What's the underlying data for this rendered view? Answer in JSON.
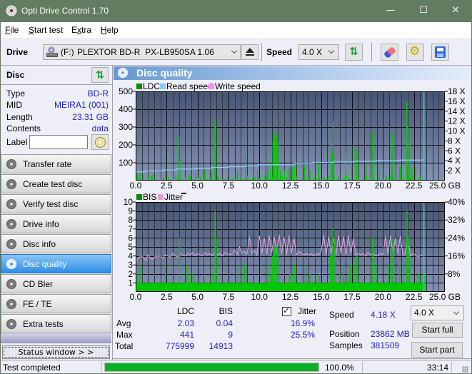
{
  "window": {
    "title": "Opti Drive Control 1.70",
    "minimize_glyph": "—",
    "maximize_glyph": "☐",
    "close_glyph": "✕"
  },
  "menu": [
    {
      "pre": "",
      "key": "F",
      "post": "ile"
    },
    {
      "pre": "",
      "key": "S",
      "post": "tart test"
    },
    {
      "pre": "E",
      "key": "x",
      "post": "tra"
    },
    {
      "pre": "",
      "key": "H",
      "post": "elp"
    }
  ],
  "toolbar": {
    "drive_label": "Drive",
    "drive_letter": "(F:)",
    "drive_name": "PLEXTOR BD-R  PX-LB950SA 1.06",
    "speed_label": "Speed",
    "speed_value": "4.0 X"
  },
  "disc": {
    "header": "Disc",
    "fields": [
      {
        "label": "Type",
        "value": "BD-R"
      },
      {
        "label": "MID",
        "value": "MEIRA1 (001)"
      },
      {
        "label": "Length",
        "value": "23.31 GB"
      },
      {
        "label": "Contents",
        "value": "data"
      }
    ],
    "label_field": {
      "label": "Label",
      "value": ""
    }
  },
  "nav": {
    "items": [
      "Transfer rate",
      "Create test disc",
      "Verify test disc",
      "Drive info",
      "Disc info",
      "Disc quality",
      "CD Bler",
      "FE / TE",
      "Extra tests"
    ],
    "selected": "Disc quality"
  },
  "status_window_button": "Status window > >",
  "panel": {
    "title": "Disc quality"
  },
  "stats": {
    "col_ldc": "LDC",
    "col_bis": "BIS",
    "rows": [
      {
        "label": "Avg",
        "ldc": "2.03",
        "bis": "0.04",
        "jitter": "16.9%"
      },
      {
        "label": "Max",
        "ldc": "441",
        "bis": "9",
        "jitter": "25.5%"
      },
      {
        "label": "Total",
        "ldc": "775999",
        "bis": "14913"
      }
    ],
    "jitter_label": "Jitter",
    "jitter_checked": true,
    "speed_label": "Speed",
    "speed_value": "4.18 X",
    "position_label": "Position",
    "position_value": "23862 MB",
    "samples_label": "Samples",
    "samples_value": "381509",
    "speed_select": "4.0 X",
    "start_full": "Start full",
    "start_part": "Start part"
  },
  "statusbar": {
    "text": "Test completed",
    "progress_percent": 100.0,
    "progress_text": "100.0%",
    "elapsed": "33:14"
  },
  "colors": {
    "titlebar": "#627c62",
    "value_text": "#2222cc",
    "selected_nav": "#2e8ee8",
    "bars": "#00c800",
    "read_speed": "#88ccff",
    "jitter": "#e0a6e0",
    "end_marker": "#40c8f8",
    "progress": "#06b025"
  },
  "chart_data": [
    {
      "id": "ldc",
      "type": "bar",
      "title": "",
      "legend": [
        {
          "label": "LDC",
          "color": "#008c00"
        },
        {
          "label": "Read speed",
          "color": "#88ccff"
        },
        {
          "label": "Write speed",
          "color": "#ff88ff"
        }
      ],
      "legend_position": "top-left",
      "xlabel": "GB",
      "xlim": [
        0,
        25
      ],
      "x_ticks": [
        0,
        2.5,
        5,
        7.5,
        10,
        12.5,
        15,
        17.5,
        20,
        22.5,
        25
      ],
      "x_tick_labels": [
        "0.0",
        "2.5",
        "5.0",
        "7.5",
        "10.0",
        "12.5",
        "15.0",
        "17.5",
        "20.0",
        "22.5",
        "25.0 GB"
      ],
      "x_minor_step": 0.5,
      "x_major_step": 2.5,
      "ylabel": "LDC",
      "ylim": [
        0,
        500
      ],
      "y_grid_step": 100,
      "y_ticks": [
        100,
        200,
        300,
        400,
        500
      ],
      "y_tick_labels": [
        "100",
        "200",
        "300",
        "400",
        "500"
      ],
      "y2label": "Speed",
      "y2lim": [
        0,
        18
      ],
      "y2_ticks": [
        2,
        4,
        6,
        8,
        10,
        12,
        14,
        16,
        18
      ],
      "y2_tick_labels": [
        "2 X",
        "4 X",
        "6 X",
        "8 X",
        "10 X",
        "12 X",
        "14 X",
        "16 X",
        "18 X"
      ],
      "grid": true,
      "end_marker_gb": 23.31,
      "series": [
        {
          "name": "LDC",
          "kind": "bars_sampled",
          "axis": "left",
          "color": "#00c800",
          "x_start": 0,
          "x_step": 0.2,
          "values": [
            35,
            15,
            8,
            20,
            5,
            12,
            25,
            6,
            10,
            4,
            8,
            15,
            6,
            20,
            10,
            8,
            30,
            12,
            5,
            8,
            18,
            6,
            25,
            10,
            8,
            15,
            20,
            6,
            12,
            8,
            10,
            5,
            15,
            25,
            8,
            6,
            10,
            20,
            5,
            12,
            8,
            25,
            15,
            6,
            10,
            30,
            8,
            12,
            20,
            6,
            15,
            10,
            25,
            35,
            8,
            20,
            30,
            15,
            10,
            25,
            8,
            20,
            35,
            12,
            15,
            25,
            8,
            10,
            30,
            6,
            15,
            8,
            20,
            10,
            25,
            6,
            18,
            12,
            30,
            20,
            10,
            8,
            25,
            6,
            15,
            30,
            20,
            10,
            8,
            25,
            12,
            6,
            15,
            25,
            8,
            10,
            20,
            6,
            15,
            8,
            10,
            25,
            15,
            30,
            20,
            12,
            8,
            35,
            25,
            10,
            30,
            15,
            25,
            8,
            12,
            20,
            10
          ]
        },
        {
          "name": "LDC peaks",
          "kind": "bars",
          "axis": "left",
          "color": "#00c800",
          "points": [
            [
              0.08,
              40
            ],
            [
              0.3,
              50
            ],
            [
              1.3,
              33
            ],
            [
              2.37,
              183
            ],
            [
              3.46,
              252
            ],
            [
              3.52,
              110
            ],
            [
              4.27,
              40
            ],
            [
              4.79,
              40
            ],
            [
              5.55,
              60
            ],
            [
              6.1,
              45
            ],
            [
              6.37,
              345
            ],
            [
              6.43,
              305
            ],
            [
              8.18,
              55
            ],
            [
              8.85,
              152
            ],
            [
              9.82,
              60
            ],
            [
              10.64,
              112
            ],
            [
              10.87,
              60
            ],
            [
              11.06,
              215
            ],
            [
              11.16,
              272
            ],
            [
              11.36,
              255
            ],
            [
              11.45,
              215
            ],
            [
              11.66,
              55
            ],
            [
              12.0,
              60
            ],
            [
              12.37,
              65
            ],
            [
              12.6,
              70
            ],
            [
              12.8,
              80
            ],
            [
              13.57,
              72
            ],
            [
              13.62,
              85
            ],
            [
              14.05,
              55
            ],
            [
              14.75,
              95
            ],
            [
              15.78,
              200
            ],
            [
              15.86,
              160
            ],
            [
              15.94,
              335
            ],
            [
              16.94,
              155
            ],
            [
              17.42,
              190
            ],
            [
              17.8,
              175
            ],
            [
              18.57,
              90
            ],
            [
              19.12,
              276
            ],
            [
              19.64,
              85
            ],
            [
              20.65,
              265
            ],
            [
              20.75,
              262
            ],
            [
              21.3,
              75
            ],
            [
              21.4,
              85
            ],
            [
              21.88,
              441
            ],
            [
              21.95,
              300
            ],
            [
              22.1,
              210
            ],
            [
              22.3,
              75
            ],
            [
              22.6,
              67
            ]
          ]
        },
        {
          "name": "Read speed",
          "kind": "step_line",
          "axis": "right",
          "color": "#88ccff",
          "points": [
            [
              0,
              1.76
            ],
            [
              0.8,
              1.95
            ],
            [
              2.2,
              2.14
            ],
            [
              3.3,
              2.33
            ],
            [
              4.85,
              2.48
            ],
            [
              6.1,
              2.67
            ],
            [
              7.5,
              2.81
            ],
            [
              8.85,
              2.95
            ],
            [
              9.9,
              3.19
            ],
            [
              12.8,
              3.43
            ],
            [
              14.34,
              3.67
            ],
            [
              15.97,
              3.76
            ],
            [
              17.7,
              3.9
            ],
            [
              19.44,
              4.0
            ],
            [
              21.27,
              4.14
            ],
            [
              23.1,
              4.18
            ],
            [
              23.31,
              4.18
            ]
          ]
        }
      ]
    },
    {
      "id": "bis",
      "type": "bar",
      "title": "",
      "legend": [
        {
          "label": "BIS",
          "color": "#008c00"
        },
        {
          "label": "Jitter",
          "color": "#dda0dd"
        }
      ],
      "legend_position": "top-left",
      "xlabel": "GB",
      "xlim": [
        0,
        25
      ],
      "x_ticks": [
        0,
        2.5,
        5,
        7.5,
        10,
        12.5,
        15,
        17.5,
        20,
        22.5,
        25
      ],
      "x_tick_labels": [
        "0.0",
        "2.5",
        "5.0",
        "7.5",
        "10.0",
        "12.5",
        "15.0",
        "17.5",
        "20.0",
        "22.5",
        "25.0 GB"
      ],
      "x_minor_step": 0.5,
      "x_major_step": 2.5,
      "ylabel": "BIS",
      "ylim": [
        0,
        10
      ],
      "y_grid_step": 1,
      "y_ticks": [
        1,
        2,
        3,
        4,
        5,
        6,
        7,
        8,
        9,
        10
      ],
      "y_tick_labels": [
        "1",
        "2",
        "3",
        "4",
        "5",
        "6",
        "7",
        "8",
        "9",
        "10"
      ],
      "y2label": "Jitter",
      "y2lim": [
        0,
        40
      ],
      "y2_ticks": [
        8,
        16,
        24,
        32,
        40
      ],
      "y2_tick_labels": [
        "8%",
        "16%",
        "24%",
        "32%",
        "40%"
      ],
      "grid": true,
      "end_marker_gb": 23.31,
      "series": [
        {
          "name": "Jitter",
          "kind": "line_sampled",
          "axis": "right",
          "color": "#e0a6e0",
          "x_start": 0,
          "x_step": 0.2,
          "values": [
            13.5,
            15,
            16,
            15.5,
            14,
            16.5,
            15,
            14.5,
            16,
            15.5,
            16,
            15,
            16.5,
            16,
            15.5,
            17,
            16,
            15.5,
            17,
            16.5,
            16,
            17,
            16.5,
            17.5,
            16,
            17,
            16.5,
            16,
            17.5,
            16.5,
            17,
            16,
            17.5,
            16.5,
            17,
            16,
            17.5,
            17,
            16.5,
            17,
            18.5,
            16.5,
            20,
            17,
            18,
            16.5,
            24.5,
            17,
            18.5,
            16.5,
            25,
            17,
            24,
            16.5,
            25,
            17.5,
            24.5,
            17,
            25.5,
            17,
            24.5,
            16.5,
            25,
            17,
            24,
            16.5,
            18,
            17,
            16.5,
            17,
            16.5,
            17,
            16,
            17,
            16.5,
            18,
            25,
            16.5,
            24.5,
            17,
            24,
            16.5,
            25,
            17,
            24.5,
            16.5,
            25,
            17,
            24,
            16.5,
            17,
            16.5,
            17,
            16,
            17.5,
            16.5,
            17,
            16,
            16.5,
            17,
            16.5,
            24.5,
            17,
            25,
            16.5,
            24,
            17,
            25,
            16.5,
            17,
            24.5,
            16,
            17,
            16.5,
            15.5,
            16,
            16.5
          ]
        },
        {
          "name": "BIS",
          "kind": "band",
          "axis": "left",
          "color": "#00c800",
          "x_from": 0,
          "x_to": 23.31,
          "value": 1
        },
        {
          "name": "BIS peaks",
          "kind": "bars",
          "axis": "left",
          "color": "#00c800",
          "points": [
            [
              0.08,
              2
            ],
            [
              0.3,
              3
            ],
            [
              2.39,
              3
            ],
            [
              3.5,
              6
            ],
            [
              4.1,
              3
            ],
            [
              4.4,
              2
            ],
            [
              4.6,
              2
            ],
            [
              6.2,
              2
            ],
            [
              6.39,
              9
            ],
            [
              6.47,
              6
            ],
            [
              8.2,
              3
            ],
            [
              8.75,
              3
            ],
            [
              8.85,
              3
            ],
            [
              10.66,
              3
            ],
            [
              10.9,
              2
            ],
            [
              11.0,
              4
            ],
            [
              11.16,
              5
            ],
            [
              11.39,
              5
            ],
            [
              11.45,
              5
            ],
            [
              12.4,
              2
            ],
            [
              12.51,
              2
            ],
            [
              12.8,
              3
            ],
            [
              13.67,
              3
            ],
            [
              14.05,
              2
            ],
            [
              14.78,
              2
            ],
            [
              15.7,
              4
            ],
            [
              15.78,
              4
            ],
            [
              15.9,
              7
            ],
            [
              15.96,
              5
            ],
            [
              16.07,
              6
            ],
            [
              16.45,
              2
            ],
            [
              16.74,
              3
            ],
            [
              17.1,
              2
            ],
            [
              17.28,
              3
            ],
            [
              17.4,
              3
            ],
            [
              17.6,
              3
            ],
            [
              17.82,
              4
            ],
            [
              19.09,
              6
            ],
            [
              19.4,
              3
            ],
            [
              20.4,
              3
            ],
            [
              20.65,
              5
            ],
            [
              20.75,
              6
            ],
            [
              21.3,
              3
            ],
            [
              21.6,
              3
            ],
            [
              21.9,
              9
            ],
            [
              22.0,
              6
            ],
            [
              22.1,
              4
            ],
            [
              22.8,
              2
            ],
            [
              23.3,
              2
            ]
          ]
        }
      ]
    }
  ]
}
